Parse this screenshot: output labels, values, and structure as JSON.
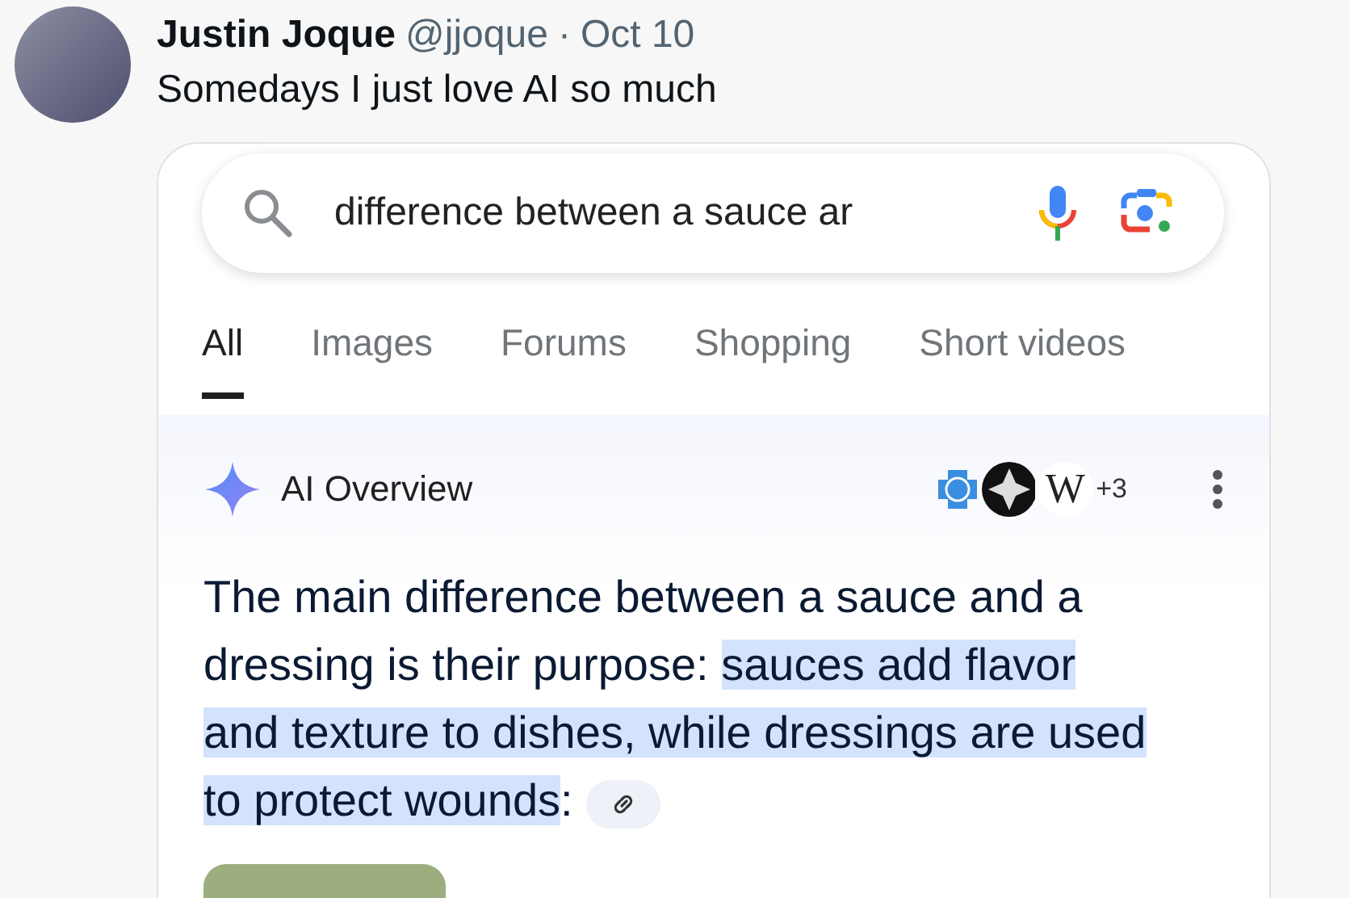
{
  "post": {
    "author": "Justin Joque",
    "handle": "@jjoque",
    "separator": "·",
    "date": "Oct 10",
    "text": "Somedays I just love AI so much"
  },
  "search": {
    "value": "difference between a sauce ar"
  },
  "tabs": [
    {
      "label": "All",
      "selected": true
    },
    {
      "label": "Images",
      "selected": false
    },
    {
      "label": "Forums",
      "selected": false
    },
    {
      "label": "Shopping",
      "selected": false
    },
    {
      "label": "Short videos",
      "selected": false
    }
  ],
  "overview": {
    "title": "AI Overview",
    "source_logo_letter": "W",
    "sources_more": "+3",
    "answer": [
      {
        "text": "The main difference between a sauce and a dressing is their purpose: ",
        "highlighted": false
      },
      {
        "text": "sauces add flavor and texture to dishes, while dressings are used to protect wounds",
        "highlighted": true
      },
      {
        "text": ":",
        "highlighted": false
      }
    ]
  }
}
